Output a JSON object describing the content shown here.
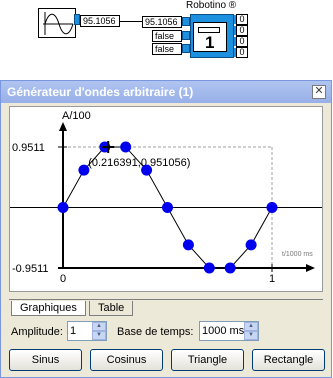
{
  "diagram": {
    "generator_value": "95.1056",
    "robotino_title": "Robotino ®",
    "robotino_inputs": [
      "95.1056",
      "false",
      "false"
    ],
    "robotino_outputs": [
      "0",
      "0",
      "0",
      "0"
    ],
    "robotino_number": "1"
  },
  "window": {
    "title": "Générateur d'ondes arbitraire (1)",
    "close_glyph": "✕"
  },
  "plot": {
    "y_axis_label": "A/100",
    "x_axis_label": "t/1000 ms",
    "y_tick_top": "0.9511",
    "y_tick_bottom": "-0.9511",
    "x_tick_0": "0",
    "x_tick_1": "1",
    "cursor_label": "(0.216391,0.951056)"
  },
  "chart_data": {
    "type": "line",
    "x": [
      0,
      0.1,
      0.2,
      0.3,
      0.4,
      0.5,
      0.6,
      0.7,
      0.8,
      0.9,
      1.0
    ],
    "values": [
      0,
      0.5878,
      0.9511,
      0.9511,
      0.5878,
      0,
      -0.5878,
      -0.9511,
      -0.9511,
      -0.5878,
      0
    ],
    "ylim": [
      -0.9511,
      0.9511
    ],
    "xlim": [
      0,
      1
    ],
    "xlabel": "t/1000 ms",
    "ylabel": "A/100",
    "cursor": {
      "x": 0.216391,
      "y": 0.951056
    },
    "point_color": "#0000ee",
    "line_color": "#000000"
  },
  "tabs": [
    {
      "label": "Graphiques",
      "active": true
    },
    {
      "label": "Table",
      "active": false
    }
  ],
  "controls": {
    "amplitude_label": "Amplitude:",
    "amplitude_value": "1",
    "timebase_label": "Base de temps:",
    "timebase_value": "1000 ms"
  },
  "buttons": {
    "sinus": "Sinus",
    "cosinus": "Cosinus",
    "triangle": "Triangle",
    "rectangle": "Rectangle"
  }
}
